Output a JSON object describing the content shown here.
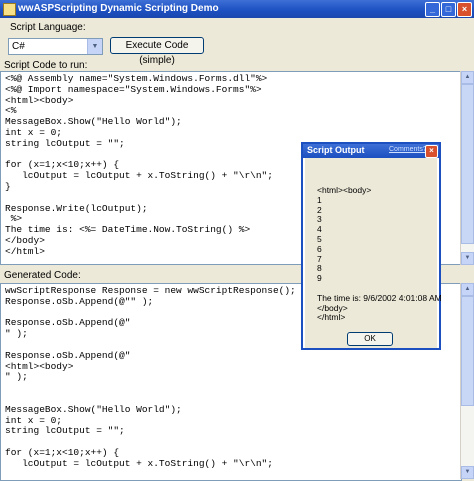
{
  "window": {
    "title": "wwASPScripting Dynamic Scripting Demo",
    "controls": [
      "_",
      "□",
      "×"
    ]
  },
  "top": {
    "language_label": "Script Language:",
    "language_value": "C#",
    "execute_label": "Execute Code (simple)"
  },
  "script": {
    "label": "Script Code to run:",
    "code": "<%@ Assembly name=\"System.Windows.Forms.dll\"%>\n<%@ Import namespace=\"System.Windows.Forms\"%>\n<html><body>\n<%\nMessageBox.Show(\"Hello World\");\nint x = 0;\nstring lcOutput = \"\";\n\nfor (x=1;x<10;x++) {\n   lcOutput = lcOutput + x.ToString() + \"\\r\\n\";\n}\n\nResponse.Write(lcOutput);\n %>\nThe time is: <%= DateTime.Now.ToString() %>\n</body>\n</html>"
  },
  "generated": {
    "label": "Generated Code:",
    "code": "wwScriptResponse Response = new wwScriptResponse();\nResponse.oSb.Append(@\"\" );\n\nResponse.oSb.Append(@\"\n\" );\n\nResponse.oSb.Append(@\"\n<html><body>\n\" );\n\n\nMessageBox.Show(\"Hello World\");\nint x = 0;\nstring lcOutput = \"\";\n\nfor (x=1;x<10;x++) {\n   lcOutput = lcOutput + x.ToString() + \"\\r\\n\";"
  },
  "dialog": {
    "title": "Script Output",
    "comments_link": "Comments?",
    "close": "×",
    "content": "<html><body>\n1\n2\n3\n4\n5\n6\n7\n8\n9\n\nThe time is: 9/6/2002 4:01:08 AM\n</body>\n</html>",
    "ok_label": "OK"
  }
}
